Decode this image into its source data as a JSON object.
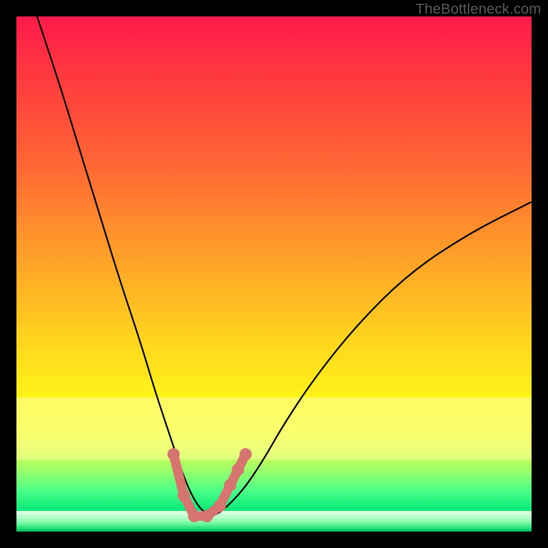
{
  "watermark": "TheBottleneck.com",
  "chart_data": {
    "type": "line",
    "title": "",
    "xlabel": "",
    "ylabel": "",
    "xlim": [
      0,
      100
    ],
    "ylim": [
      0,
      100
    ],
    "series": [
      {
        "name": "bottleneck-curve",
        "x": [
          4,
          8,
          12,
          16,
          20,
          24,
          27,
          30,
          32,
          34,
          36,
          38,
          40,
          44,
          48,
          52,
          58,
          66,
          76,
          88,
          100
        ],
        "y": [
          100,
          88,
          75,
          62,
          49,
          37,
          27,
          18,
          12,
          7,
          4,
          3,
          4,
          8,
          14,
          21,
          30,
          40,
          50,
          58,
          64
        ]
      }
    ],
    "markers": {
      "name": "highlighted-points",
      "color": "#d6746f",
      "points": [
        {
          "x": 30.5,
          "y": 15
        },
        {
          "x": 32.5,
          "y": 7
        },
        {
          "x": 34.5,
          "y": 3
        },
        {
          "x": 37.0,
          "y": 3
        },
        {
          "x": 39.5,
          "y": 5
        },
        {
          "x": 41.5,
          "y": 9
        },
        {
          "x": 43.0,
          "y": 12
        },
        {
          "x": 44.5,
          "y": 15
        }
      ]
    },
    "bands": {
      "yellow": {
        "from_y": 74,
        "to_y": 86
      },
      "green_steps": [
        96,
        96.8,
        97.5,
        98.1,
        98.6,
        99.0,
        99.4,
        99.7,
        100
      ]
    }
  }
}
